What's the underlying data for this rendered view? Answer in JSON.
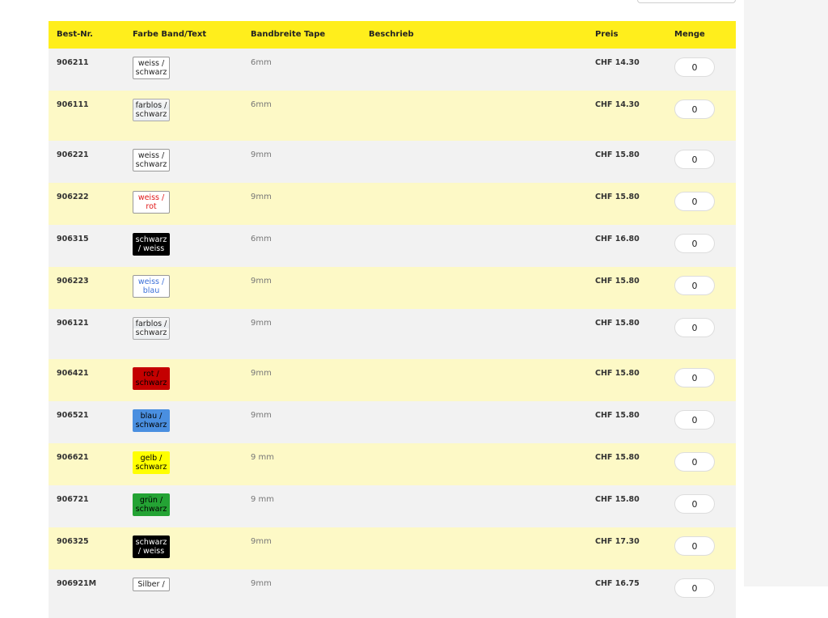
{
  "table": {
    "headers": {
      "nr": "Best-Nr.",
      "color": "Farbe Band/Text",
      "bandwidth": "Bandbreite Tape",
      "desc": "Beschrieb",
      "price": "Preis",
      "qty": "Menge"
    },
    "rows": [
      {
        "nr": "906211",
        "swatch": "weiss / schwarz",
        "bg": "#ffffff",
        "fg": "#222222",
        "bandwidth": "6mm",
        "price": "CHF 14.30",
        "qty": "0"
      },
      {
        "nr": "906111",
        "swatch": "farblos / schwarz",
        "bg": "clear",
        "fg": "#222222",
        "bandwidth": "6mm",
        "price": "CHF 14.30",
        "qty": "0"
      },
      {
        "nr": "906221",
        "swatch": "weiss / schwarz",
        "bg": "#ffffff",
        "fg": "#222222",
        "bandwidth": "9mm",
        "price": "CHF 15.80",
        "qty": "0"
      },
      {
        "nr": "906222",
        "swatch": "weiss / rot",
        "bg": "#ffffff",
        "fg": "#e01818",
        "bandwidth": "9mm",
        "price": "CHF 15.80",
        "qty": "0"
      },
      {
        "nr": "906315",
        "swatch": "schwarz / weiss",
        "bg": "#000000",
        "fg": "#ffffff",
        "bandwidth": "6mm",
        "price": "CHF 16.80",
        "qty": "0"
      },
      {
        "nr": "906223",
        "swatch": "weiss / blau",
        "bg": "#ffffff",
        "fg": "#3a6fd8",
        "bandwidth": "9mm",
        "price": "CHF 15.80",
        "qty": "0"
      },
      {
        "nr": "906121",
        "swatch": "farblos / schwarz",
        "bg": "clear",
        "fg": "#222222",
        "bandwidth": "9mm",
        "price": "CHF 15.80",
        "qty": "0"
      },
      {
        "nr": "906421",
        "swatch": "rot / schwarz",
        "bg": "#c40000",
        "fg": "#000000",
        "bandwidth": "9mm",
        "price": "CHF 15.80",
        "qty": "0"
      },
      {
        "nr": "906521",
        "swatch": "blau / schwarz",
        "bg": "#4a8fe0",
        "fg": "#000000",
        "bandwidth": "9mm",
        "price": "CHF 15.80",
        "qty": "0"
      },
      {
        "nr": "906621",
        "swatch": "gelb / schwarz",
        "bg": "#ffff00",
        "fg": "#000000",
        "bandwidth": "9 mm",
        "price": "CHF 15.80",
        "qty": "0"
      },
      {
        "nr": "906721",
        "swatch": "grün / schwarz",
        "bg": "#24a334",
        "fg": "#000000",
        "bandwidth": "9 mm",
        "price": "CHF 15.80",
        "qty": "0"
      },
      {
        "nr": "906325",
        "swatch": "schwarz / weiss",
        "bg": "#000000",
        "fg": "#ffffff",
        "bandwidth": "9mm",
        "price": "CHF 17.30",
        "qty": "0"
      },
      {
        "nr": "906921M",
        "swatch": "Silber /",
        "bg": "#ffffff",
        "fg": "#222222",
        "bandwidth": "9mm",
        "price": "CHF 16.75",
        "qty": "0"
      }
    ]
  }
}
